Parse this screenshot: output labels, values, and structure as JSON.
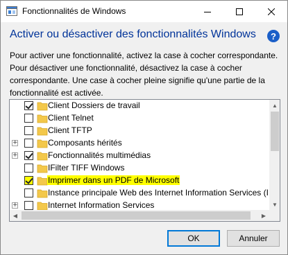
{
  "window": {
    "title": "Fonctionnalités de Windows",
    "minimize_glyph": "—",
    "maximize_glyph": "☐",
    "close_glyph": "✕"
  },
  "header": {
    "heading": "Activer ou désactiver des fonctionnalités Windows",
    "help_glyph": "?",
    "description_lines": [
      "Pour activer une fonctionnalité, activez la case à cocher correspondante.",
      "Pour désactiver une fonctionnalité, désactivez la case à cocher",
      "correspondante. Une case à cocher pleine signifie qu'une partie de la",
      "fonctionnalité est activée."
    ]
  },
  "features": [
    {
      "label": "Client Dossiers de travail",
      "checked": true,
      "expandable": false,
      "highlight": false
    },
    {
      "label": "Client Telnet",
      "checked": false,
      "expandable": false,
      "highlight": false
    },
    {
      "label": "Client TFTP",
      "checked": false,
      "expandable": false,
      "highlight": false
    },
    {
      "label": "Composants hérités",
      "checked": false,
      "expandable": true,
      "highlight": false
    },
    {
      "label": "Fonctionnalités multimédias",
      "checked": true,
      "expandable": true,
      "highlight": false
    },
    {
      "label": "IFilter TIFF Windows",
      "checked": false,
      "expandable": false,
      "highlight": false
    },
    {
      "label": "Imprimer dans un PDF de Microsoft",
      "checked": true,
      "expandable": false,
      "highlight": true
    },
    {
      "label": "Instance principale Web des Internet Information Services (IIS",
      "checked": false,
      "expandable": false,
      "highlight": false
    },
    {
      "label": "Internet Information Services",
      "checked": false,
      "expandable": true,
      "highlight": false
    }
  ],
  "buttons": {
    "ok": "OK",
    "cancel": "Annuler"
  },
  "colors": {
    "heading": "#003399",
    "highlight": "#ffff00",
    "folder": "#f3c84b",
    "accent": "#0078d7"
  }
}
